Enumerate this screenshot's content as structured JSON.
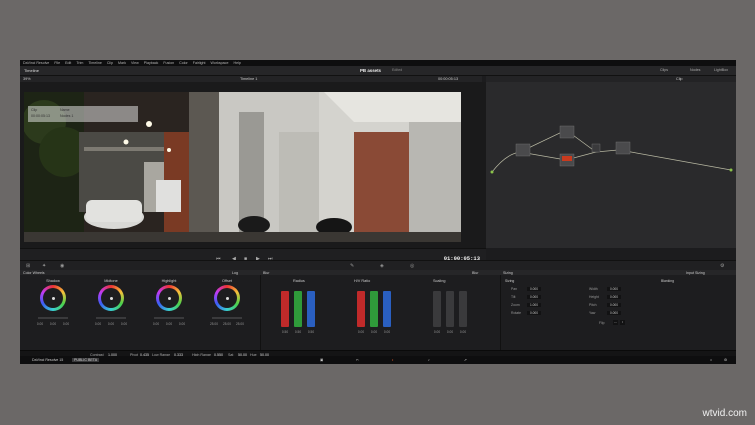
{
  "menu": [
    "DaVinci Resolve",
    "File",
    "Edit",
    "Trim",
    "Timeline",
    "Clip",
    "Mark",
    "View",
    "Playback",
    "Fusion",
    "Color",
    "Fairlight",
    "Workspace",
    "Help"
  ],
  "title_bar": {
    "left": "Timeline",
    "project": "PB assets",
    "status": "Edited",
    "clips": "Clips",
    "nodes": "Nodes",
    "lightbox": "LightBox"
  },
  "viewer_bar": {
    "zoom": "39%",
    "timeline": "Timeline 1",
    "timecode": "00:00:05:13",
    "clip_label": "Clip"
  },
  "info_box": {
    "col1": "Clip",
    "col2": "Name",
    "tc": "00:00:05:13",
    "name": "Nodes 1"
  },
  "transport": {
    "timecode": "01:00:05:13"
  },
  "panels": {
    "color_wheels": "Color Wheels",
    "log": "Log",
    "blur": "Blur",
    "blur2": "Blur",
    "sizing": "Sizing",
    "input_sizing": "Input Sizing"
  },
  "wheels": [
    {
      "label": "Shadow",
      "vals": [
        "0.00",
        "0.00",
        "0.00"
      ]
    },
    {
      "label": "Midtone",
      "vals": [
        "0.00",
        "0.00",
        "0.00"
      ]
    },
    {
      "label": "Highlight",
      "vals": [
        "0.00",
        "0.00",
        "0.00"
      ]
    },
    {
      "label": "Offset",
      "vals": [
        "25.00",
        "25.00",
        "25.00"
      ]
    }
  ],
  "wheel_footer": {
    "contrast": "Contrast",
    "contrast_val": "1.000",
    "pivot": "Pivot",
    "pivot_val": "0.435",
    "low_range": "Low Range",
    "low_val": "0.333",
    "high_range": "High Range",
    "high_val": "0.550",
    "sat": "Sat",
    "sat_val": "50.00",
    "hue": "Hue",
    "hue_val": "50.00"
  },
  "blur": {
    "radius": "Radius",
    "hv_ratio": "H/V Ratio",
    "scaling": "Scaling",
    "r_vals": [
      "0.50",
      "0.50",
      "0.50"
    ],
    "hv_vals": [
      "0.00",
      "0.00",
      "0.00"
    ],
    "sc_vals": [
      "0.00",
      "0.00",
      "0.00"
    ]
  },
  "sizing": {
    "header": "Sizing",
    "rows": [
      {
        "label": "Pan",
        "val": "0.000"
      },
      {
        "label": "Tilt",
        "val": "0.000"
      },
      {
        "label": "Zoom",
        "val": "1.000"
      },
      {
        "label": "Rotate",
        "val": "0.000"
      }
    ],
    "rows2": [
      {
        "label": "Width",
        "val": "0.000"
      },
      {
        "label": "Height",
        "val": "0.000"
      },
      {
        "label": "Pitch",
        "val": "0.000"
      },
      {
        "label": "Yaw",
        "val": "0.000"
      }
    ],
    "flip": "Flip",
    "blanking": "Blanking"
  },
  "bottom": {
    "app": "DaVinci Resolve 15",
    "badge": "PUBLIC BETA"
  },
  "watermark": "wtvid.com",
  "colors": {
    "red": "#c02a2a",
    "green": "#2f9a3a",
    "blue": "#2a5fc0",
    "bg": "#1c1c1e"
  }
}
